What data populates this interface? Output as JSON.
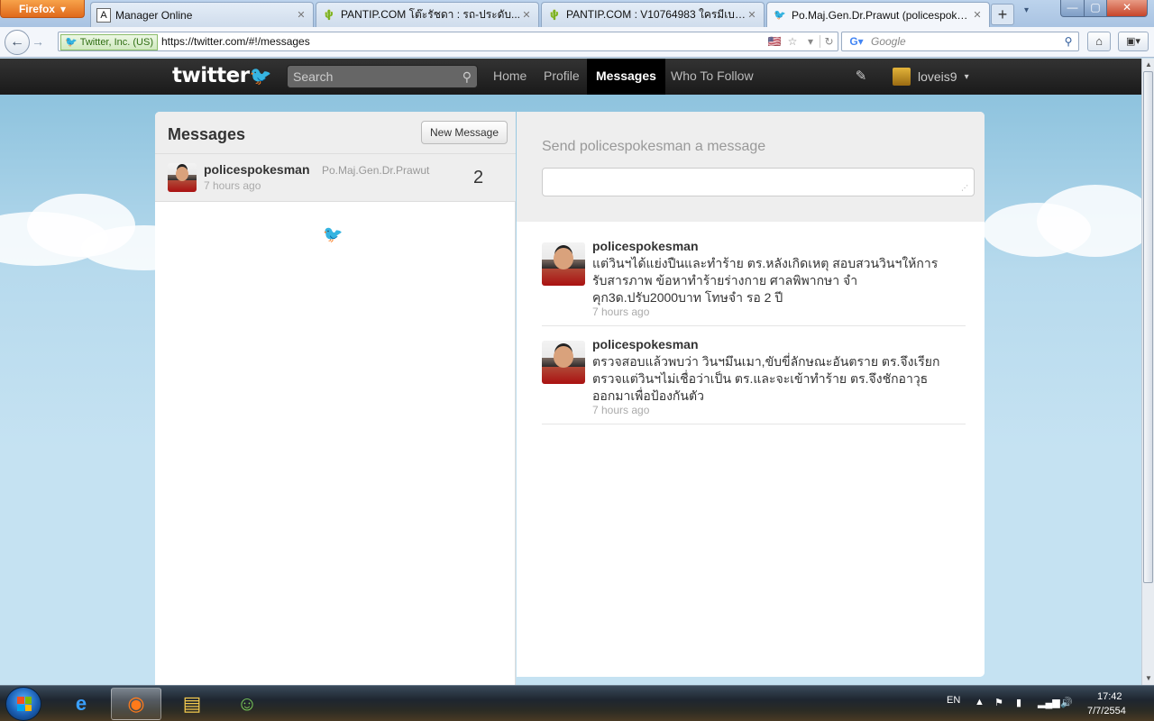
{
  "browser": {
    "menu_label": "Firefox",
    "tabs": [
      {
        "title": "Manager Online",
        "icon": "A"
      },
      {
        "title": "PANTIP.COM โต๊ะรัชดา : รถ-ประดับ...",
        "icon": "🌵"
      },
      {
        "title": "PANTIP.COM : V10764983 ใครมีเบอร...",
        "icon": "🌵"
      },
      {
        "title": "Po.Maj.Gen.Dr.Prawut (policespokes...",
        "icon": "🐦"
      }
    ],
    "site_identity": "Twitter, Inc. (US)",
    "url": "https://twitter.com/#!/messages",
    "search_engine_placeholder": "Google"
  },
  "twitter": {
    "logo_text": "twitter",
    "search_placeholder": "Search",
    "nav": {
      "home": "Home",
      "profile": "Profile",
      "messages": "Messages",
      "who_to_follow": "Who To Follow"
    },
    "username": "loveis9"
  },
  "messages_panel": {
    "title": "Messages",
    "new_message_label": "New Message",
    "conversation": {
      "screen_name": "policespokesman",
      "full_name": "Po.Maj.Gen.Dr.Prawut",
      "time": "7 hours ago",
      "count": "2"
    }
  },
  "conversation_panel": {
    "send_label": "Send policespokesman a message",
    "messages": [
      {
        "sender": "policespokesman",
        "text": "แต่วินฯได้แย่งปืนและทำร้าย ตร.หลังเกิดเหตุ สอบสวนวินฯให้การรับสารภาพ ข้อหาทำร้ายร่างกาย ศาลพิพากษา จำคุก3ด.ปรับ2000บาท โทษจำ รอ 2 ปี",
        "time": "7 hours ago"
      },
      {
        "sender": "policespokesman",
        "text": "ตรวจสอบแล้วพบว่า วินฯมึนเมา,ขับขี่ลักษณะอันตราย ตร.จึงเรียกตรวจแต่วินฯไม่เชื่อว่าเป็น ตร.และจะเข้าทำร้าย ตร.จึงชักอาวุธออกมาเพื่อป้องกันตัว",
        "time": "7 hours ago"
      }
    ]
  },
  "taskbar": {
    "language": "EN",
    "time": "17:42",
    "date": "7/7/2554"
  }
}
